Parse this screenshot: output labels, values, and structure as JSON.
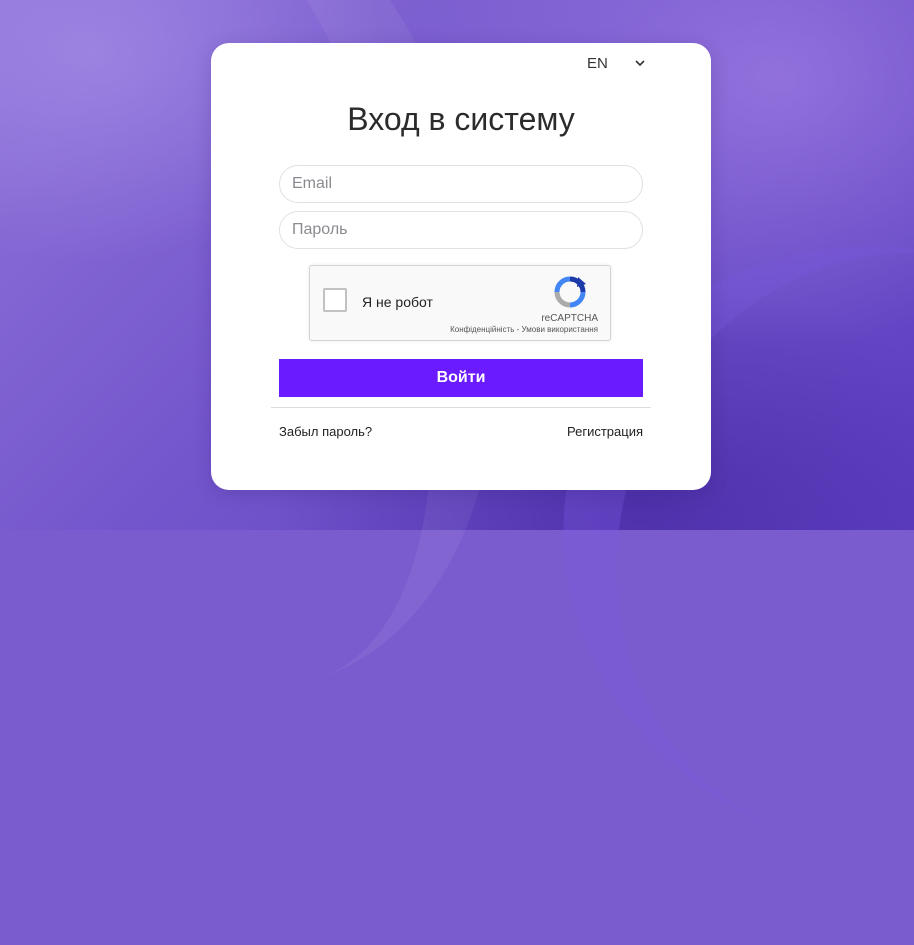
{
  "language": {
    "selected": "EN",
    "icon": "chevron-down-icon"
  },
  "login": {
    "title": "Вход в систему",
    "email_placeholder": "Email",
    "password_placeholder": "Пароль",
    "submit_label": "Войти",
    "forgot_password": "Забыл пароль?",
    "register": "Регистрация"
  },
  "captcha": {
    "label": "Я не робот",
    "brand": "reCAPTCHA",
    "privacy": "Конфіденційність",
    "separator": " - ",
    "terms": "Умови використання",
    "icon": "recaptcha-logo-icon"
  },
  "colors": {
    "accent": "#6b1bff",
    "background": "#7b5ccf",
    "card": "#ffffff"
  }
}
